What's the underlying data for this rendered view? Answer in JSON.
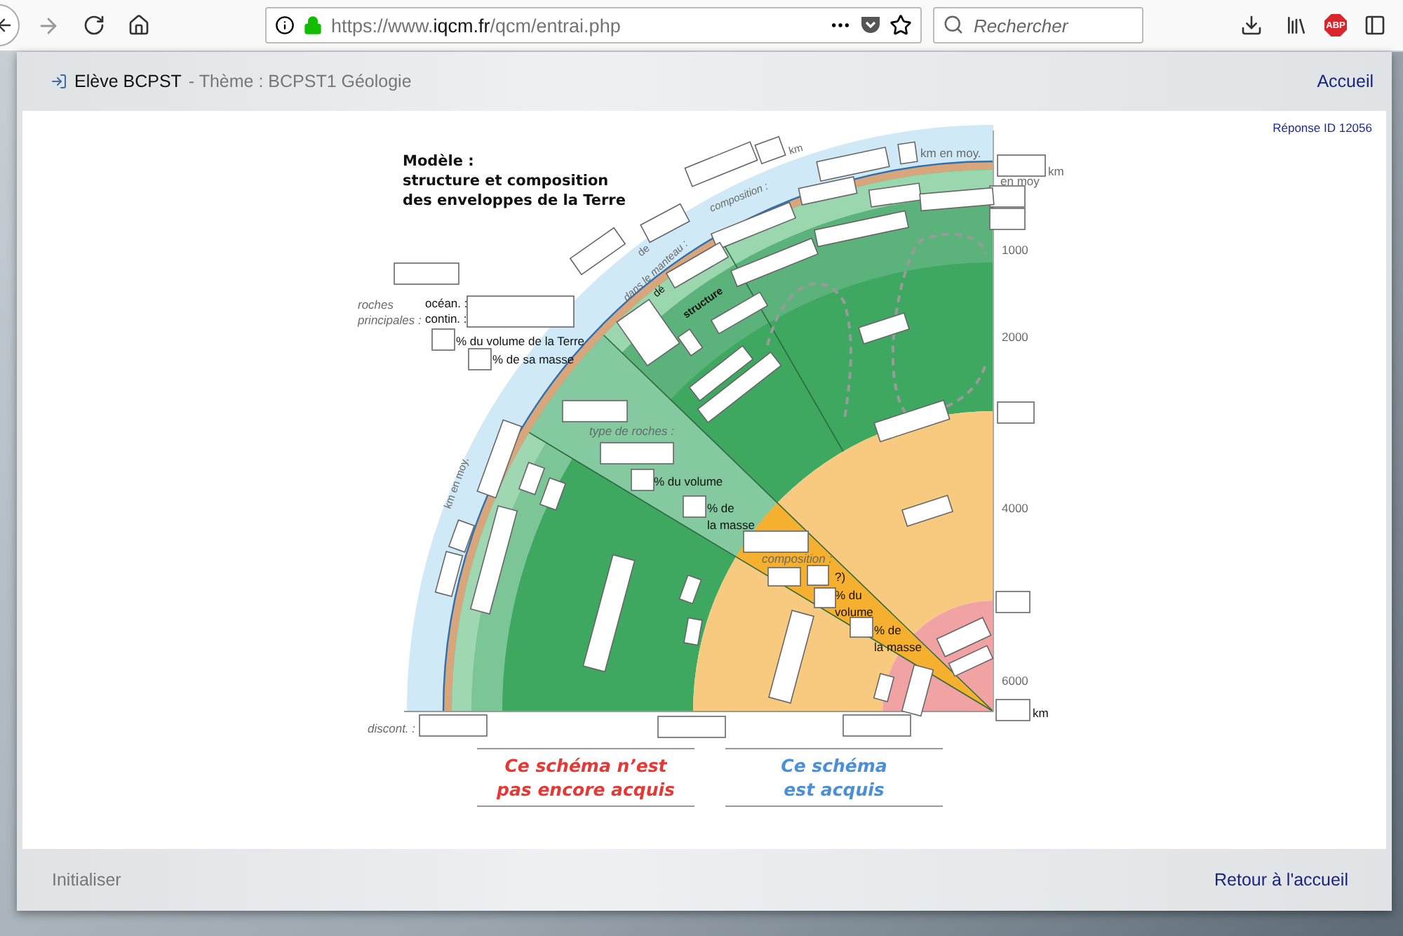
{
  "browser": {
    "url_prefix": "https://www.",
    "url_domain": "iqcm.fr",
    "url_path": "/qcm/entrai.php",
    "search_placeholder": "Rechercher",
    "adblock_badge": "ABP"
  },
  "header": {
    "user": "Elève BCPST",
    "theme": " - Thème : BCPST1 Géologie",
    "home_link": "Accueil"
  },
  "answer_id": "Réponse ID 12056",
  "diagram": {
    "title": [
      "Modèle :",
      "structure et composition",
      "des enveloppes de la Terre"
    ],
    "labels": [
      {
        "lines": [
          "roches",
          "principales :"
        ]
      },
      {
        "lines": [
          "océan. :",
          "contin. :"
        ]
      },
      {
        "lines": [
          "% du volume de la Terre"
        ]
      },
      {
        "lines": [
          "% de sa masse"
        ]
      },
      {
        "lines": [
          "de"
        ]
      },
      {
        "lines": [
          "dans le manteau :"
        ]
      },
      {
        "lines": [
          "composition :"
        ]
      },
      {
        "lines": [
          "km"
        ]
      },
      {
        "lines": [
          "km en moy."
        ]
      },
      {
        "lines": [
          "km"
        ]
      },
      {
        "lines": [
          "en moy"
        ]
      },
      {
        "lines": [
          "1000"
        ]
      },
      {
        "lines": [
          "2000"
        ]
      },
      {
        "lines": [
          "4000"
        ]
      },
      {
        "lines": [
          "6000"
        ]
      },
      {
        "lines": [
          "km"
        ]
      },
      {
        "lines": [
          "dé"
        ]
      },
      {
        "lines": [
          "structure"
        ]
      },
      {
        "lines": [
          "type de roches :"
        ]
      },
      {
        "lines": [
          "% du volume"
        ]
      },
      {
        "lines": [
          "% de",
          "la masse"
        ]
      },
      {
        "lines": [
          "km en moy."
        ]
      },
      {
        "lines": [
          "composition :"
        ]
      },
      {
        "lines": [
          "?)"
        ]
      },
      {
        "lines": [
          "% du",
          "volume"
        ]
      },
      {
        "lines": [
          "% de",
          "la masse"
        ]
      },
      {
        "lines": [
          "discont. :"
        ]
      }
    ]
  },
  "status": [
    {
      "kind": "not_acquired",
      "lines": [
        "Ce schéma n’est",
        "pas encore acquis"
      ]
    },
    {
      "kind": "acquired",
      "lines": [
        "Ce schéma",
        "est acquis"
      ]
    }
  ],
  "footer": {
    "reset": "Initialiser",
    "back_home": "Retour à l'accueil"
  }
}
